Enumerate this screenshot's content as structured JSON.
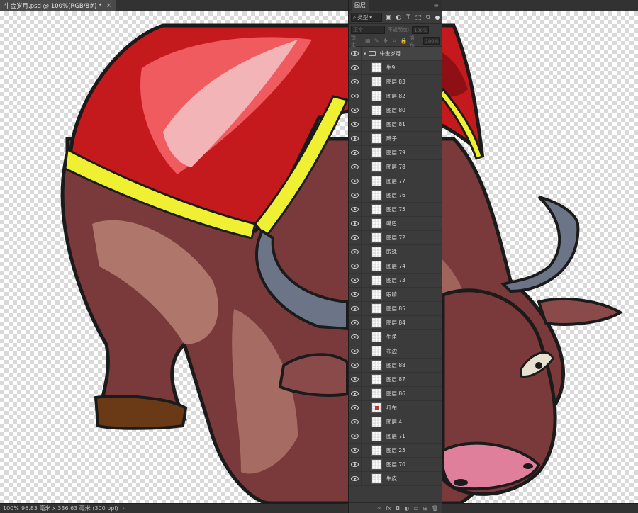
{
  "document": {
    "tab_title": "牛金岁月.psd @ 100%(RGB/8#) *",
    "close_glyph": "×"
  },
  "status": {
    "zoom": "100%",
    "doc_info": "96.83 毫米 x 336.63 毫米 (300 ppi)",
    "arrow": "›"
  },
  "panel": {
    "tab_label": "图层",
    "menu_glyph": "≡",
    "filter_kind": "类型",
    "filter_icons": [
      "image-filter-icon",
      "adjustment-filter-icon",
      "type-filter-icon",
      "shape-filter-icon",
      "smart-object-filter-icon"
    ],
    "blend_mode": "正常",
    "opacity_label": "不透明度:",
    "opacity_value": "100%",
    "lock_label": "锁定:",
    "fill_label": "填充:",
    "fill_value": "100%",
    "group_name": "牛金岁月",
    "layers": [
      {
        "name": "牛9",
        "thumb": "blank"
      },
      {
        "name": "图层 83",
        "thumb": "blank"
      },
      {
        "name": "图层 82",
        "thumb": "blank"
      },
      {
        "name": "图层 80",
        "thumb": "blank"
      },
      {
        "name": "图层 81",
        "thumb": "blank"
      },
      {
        "name": "蹄子",
        "thumb": "blank"
      },
      {
        "name": "图层 79",
        "thumb": "blank"
      },
      {
        "name": "图层 78",
        "thumb": "blank"
      },
      {
        "name": "图层 77",
        "thumb": "blank"
      },
      {
        "name": "图层 76",
        "thumb": "blank"
      },
      {
        "name": "图层 75",
        "thumb": "blank"
      },
      {
        "name": "嘴巴",
        "thumb": "blank"
      },
      {
        "name": "图层 72",
        "thumb": "blank"
      },
      {
        "name": "眼珠",
        "thumb": "blank"
      },
      {
        "name": "图层 74",
        "thumb": "blank"
      },
      {
        "name": "图层 73",
        "thumb": "blank"
      },
      {
        "name": "眼睛",
        "thumb": "blank"
      },
      {
        "name": "图层 85",
        "thumb": "blank"
      },
      {
        "name": "图层 84",
        "thumb": "blank"
      },
      {
        "name": "牛角",
        "thumb": "blank"
      },
      {
        "name": "布边",
        "thumb": "blank"
      },
      {
        "name": "图层 88",
        "thumb": "blank"
      },
      {
        "name": "图层 87",
        "thumb": "blank"
      },
      {
        "name": "图层 86",
        "thumb": "blank"
      },
      {
        "name": "红布",
        "thumb": "red"
      },
      {
        "name": "图层 4",
        "thumb": "blank"
      },
      {
        "name": "图层 71",
        "thumb": "blank"
      },
      {
        "name": "图层 25",
        "thumb": "blank"
      },
      {
        "name": "图层 70",
        "thumb": "blank"
      },
      {
        "name": "牛皮",
        "thumb": "blank"
      }
    ],
    "footer_icons": [
      "link-layers-icon",
      "fx-icon",
      "add-mask-icon",
      "adjustment-layer-icon",
      "new-group-icon",
      "new-layer-icon",
      "delete-layer-icon"
    ],
    "footer_glyphs": [
      "∞",
      "fx",
      "◘",
      "◐",
      "▭",
      "⊞",
      "🗑"
    ]
  },
  "colors": {
    "ui_bg": "#2b2b2b",
    "panel_bg": "#3b3b3b",
    "ox_body": "#7a3a3c",
    "ox_highlight": "#b98173",
    "cloth_red": "#c41a1e",
    "cloth_border": "#f0f032",
    "horn": "#6b7587",
    "hoof": "#6a3a16",
    "nose": "#e07f9c"
  }
}
